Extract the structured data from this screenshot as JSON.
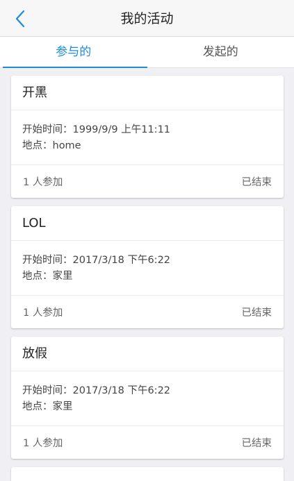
{
  "header": {
    "title": "我的活动",
    "back_icon": "chevron-left-icon",
    "accent_color": "#1b8cd8"
  },
  "tabs": [
    {
      "label": "参与的",
      "active": true
    },
    {
      "label": "发起的",
      "active": false
    }
  ],
  "activities": [
    {
      "title": "开黑",
      "start_time": "开始时间：1999/9/9 上午11:11",
      "location": "地点：home",
      "participants": "1 人参加",
      "status": "已结束"
    },
    {
      "title": "LOL",
      "start_time": "开始时间：2017/3/18 下午6:22",
      "location": "地点：家里",
      "participants": "1 人参加",
      "status": "已结束"
    },
    {
      "title": "放假",
      "start_time": "开始时间：2017/3/18 下午6:22",
      "location": "地点：家里",
      "participants": "1 人参加",
      "status": "已结束"
    }
  ]
}
